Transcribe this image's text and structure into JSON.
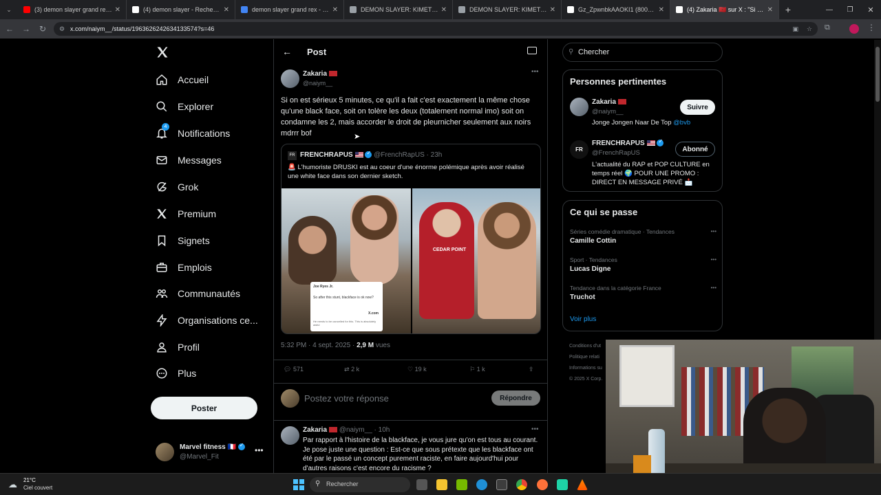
{
  "browser": {
    "tabs": [
      {
        "title": "(3) demon slayer grand rex - Yo",
        "icon": "youtube-icon",
        "color": "#ff0000"
      },
      {
        "title": "(4) demon slayer - Recherche /",
        "icon": "x-icon",
        "color": "#ffffff"
      },
      {
        "title": "demon slayer grand rex - Reche",
        "icon": "google-icon",
        "color": "#4285f4"
      },
      {
        "title": "DEMON SLAYER: KIMETSU NO",
        "icon": "page-icon",
        "color": "#9aa0a6"
      },
      {
        "title": "DEMON SLAYER: KIMETSU NO",
        "icon": "page-icon",
        "color": "#9aa0a6"
      },
      {
        "title": "Gz_ZpwnbkAAOKI1 (800×600)",
        "icon": "x-icon",
        "color": "#ffffff"
      },
      {
        "title": "(4) Zakaria 🇲🇦 sur X : \"Si on es",
        "icon": "x-icon",
        "color": "#ffffff"
      }
    ],
    "url": "x.com/naiym__/status/1963626242634133574?s=46"
  },
  "nav": {
    "items": [
      "Accueil",
      "Explorer",
      "Notifications",
      "Messages",
      "Grok",
      "Premium",
      "Signets",
      "Emplois",
      "Communautés",
      "Organisations ce...",
      "Profil",
      "Plus"
    ],
    "notif_badge": "4",
    "post_label": "Poster",
    "account_name": "Marvel fitness",
    "account_flag": "🇫🇷",
    "account_handle": "@Marvel_Fit"
  },
  "post": {
    "header": "Post",
    "author": "Zakaria",
    "handle": "@naiym__",
    "text": "Si on est sérieux 5 minutes, ce qu'il a fait c'est exactement la même chose qu'une black face, soit on tolère les deux (totalement normal imo) soit on condamne les 2, mais accorder le droit de pleurnicher seulement aux noirs mdrrr bof",
    "quote": {
      "author": "FRENCHRAPUS",
      "handle": "@FrenchRapUS",
      "time": "· 23h",
      "text": "🚨 L'humoriste DRUSKI est au coeur d'une énorme polémique après avoir réalisé une white face dans son dernier sketch."
    },
    "embedded_tweet": {
      "name": "Joe Ryes Jr.",
      "text": "So after this stunt, blackface is ok now?",
      "reply": "He needs to be cancelled for this. This is absolutely awful",
      "source": "X.com"
    },
    "shirt_text": "CEDAR POINT",
    "timestamp": "5:32 PM · 4 sept. 2025 · ",
    "views_count": "2,9 M",
    "views_label": "vues",
    "stats": {
      "replies": "571",
      "reposts": "2 k",
      "likes": "19 k",
      "bookmarks": "1 k"
    },
    "reply_placeholder": "Postez votre réponse",
    "reply_button": "Répondre"
  },
  "reply": {
    "author": "Zakaria",
    "meta": "@naiym__ · 10h",
    "text": "Par rapport à l'histoire de la blackface, je vous jure qu'on est tous au courant. Je pose juste une question : Est-ce que sous prétexte que les blackface ont été par le passé un concept purement raciste, en faire aujourd'hui pour d'autres raisons c'est encore du racisme ?"
  },
  "sidebar": {
    "search_placeholder": "Chercher",
    "relevant_title": "Personnes pertinentes",
    "people": [
      {
        "name": "Zakaria",
        "handle": "@naiym__",
        "bio": "Jonge Jongen Naar De Top ",
        "bio_link": "@bvb",
        "button": "Suivre"
      },
      {
        "name": "FRENCHRAPUS",
        "handle": "@FrenchRapUS",
        "bio": "L'actualité du RAP et POP CULTURE en temps réel 🌍 POUR UNE PROMO : DIRECT EN MESSAGE PRIVÉ 📩",
        "button": "Abonné"
      }
    ],
    "trends_title": "Ce qui se passe",
    "trends": [
      {
        "category": "Séries comédie dramatique · Tendances",
        "name": "Camille Cottin"
      },
      {
        "category": "Sport · Tendances",
        "name": "Lucas Digne"
      },
      {
        "category": "Tendance dans la catégorie France",
        "name": "Truchot"
      }
    ],
    "show_more": "Voir plus",
    "footer": [
      "Conditions d'ut",
      "Politique relati",
      "Informations su",
      "© 2025 X Corp."
    ]
  },
  "taskbar": {
    "weather_temp": "21°C",
    "weather_desc": "Ciel couvert",
    "search": "Rechercher"
  },
  "colors": {
    "accent": "#1d9bf0",
    "background": "#000000",
    "border": "#2f3336",
    "muted": "#71767b",
    "notif": "#1d9bf0"
  }
}
